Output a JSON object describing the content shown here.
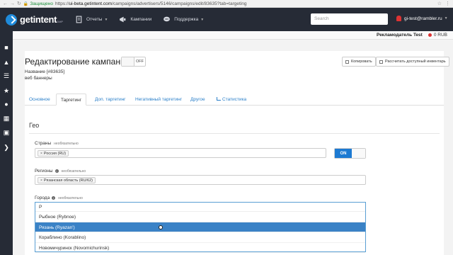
{
  "browser": {
    "secure_label": "Защищено",
    "url_prefix": "https://",
    "url_host": "ui-beta.getintent.com",
    "url_path": "/campaigns/advertisers/5146/campaigns/edit/83635?tab=targeting"
  },
  "nav": {
    "logo": "getintent",
    "logo_sup": "DMP",
    "items": [
      {
        "label": "Отчеты",
        "has_chevron": true
      },
      {
        "label": "Кампании",
        "has_chevron": false
      },
      {
        "label": "Поддержка",
        "has_chevron": true
      }
    ],
    "search_placeholder": "Search",
    "user_email": "gi-test@rambler.ru"
  },
  "subbar": {
    "advertiser": "Рекламодатель Test",
    "balance": "0 RUB"
  },
  "page": {
    "title": "Редактирование кампании",
    "toggle_label": "OFF",
    "name_line": "Название [#83635]",
    "sub_line": "веб баннеры",
    "copy_button": "Копировать",
    "calc_button": "Рассчитать доступный инвентарь"
  },
  "tabs": [
    {
      "label": "Основное",
      "active": false
    },
    {
      "label": "Таргетинг",
      "active": true
    },
    {
      "label": "Доп. таргетинг",
      "active": false
    },
    {
      "label": "Негативный таргетинг",
      "active": false
    },
    {
      "label": "Другое",
      "active": false
    },
    {
      "label": "Статистика",
      "active": false
    }
  ],
  "geo": {
    "section_title": "Гео",
    "countries_label": "Страны",
    "countries_optional": "необязательно",
    "countries_chip": "Россия (RU)",
    "on_label": "ON",
    "regions_label": "Регионы",
    "regions_optional": "необязательно",
    "regions_chip": "Рязанская область (RU/62)",
    "cities_label": "Города",
    "cities_optional": "необязательно",
    "cities_input": "Р",
    "city_options": [
      {
        "label": "Рыбное (Rybnoe)",
        "highlighted": false
      },
      {
        "label": "Рязань (Ryazan')",
        "highlighted": true
      },
      {
        "label": "Кораблино (Korablino)",
        "highlighted": false
      },
      {
        "label": "Новомичуринск (Novomichurinsk)",
        "highlighted": false
      }
    ]
  },
  "colors": {
    "nav_bg": "#262b36",
    "accent": "#1d7ad2",
    "highlight": "#3a82c6",
    "link": "#2a7fc9"
  }
}
